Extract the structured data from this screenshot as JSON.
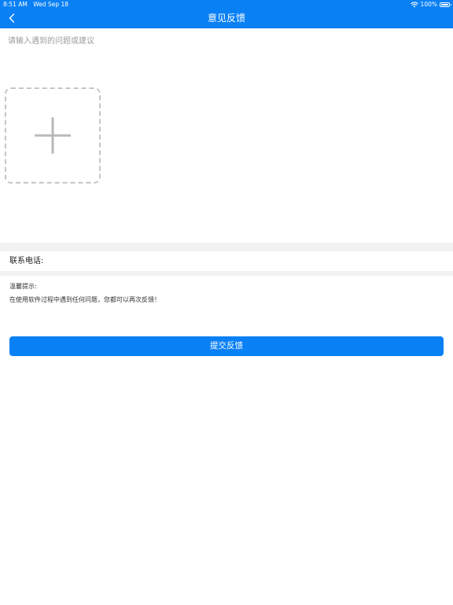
{
  "status_bar": {
    "time": "8:51 AM",
    "date": "Wed Sep 18",
    "battery_percent": "100%",
    "wifi_icon": "wifi-icon",
    "battery_icon": "battery-icon"
  },
  "header": {
    "title": "意见反馈",
    "back_icon": "chevron-left-icon",
    "background_color": "#0a80f5"
  },
  "feedback": {
    "placeholder": "请输入遇到的问题或建议",
    "value": "",
    "add_image_icon": "plus-icon"
  },
  "contact": {
    "label": "联系电话:",
    "value": ""
  },
  "tips": {
    "title": "温馨提示:",
    "body": "在使用软件过程中遇到任何问题，您都可以再次反馈！"
  },
  "submit": {
    "label": "提交反馈",
    "background_color": "#0a80f5"
  }
}
